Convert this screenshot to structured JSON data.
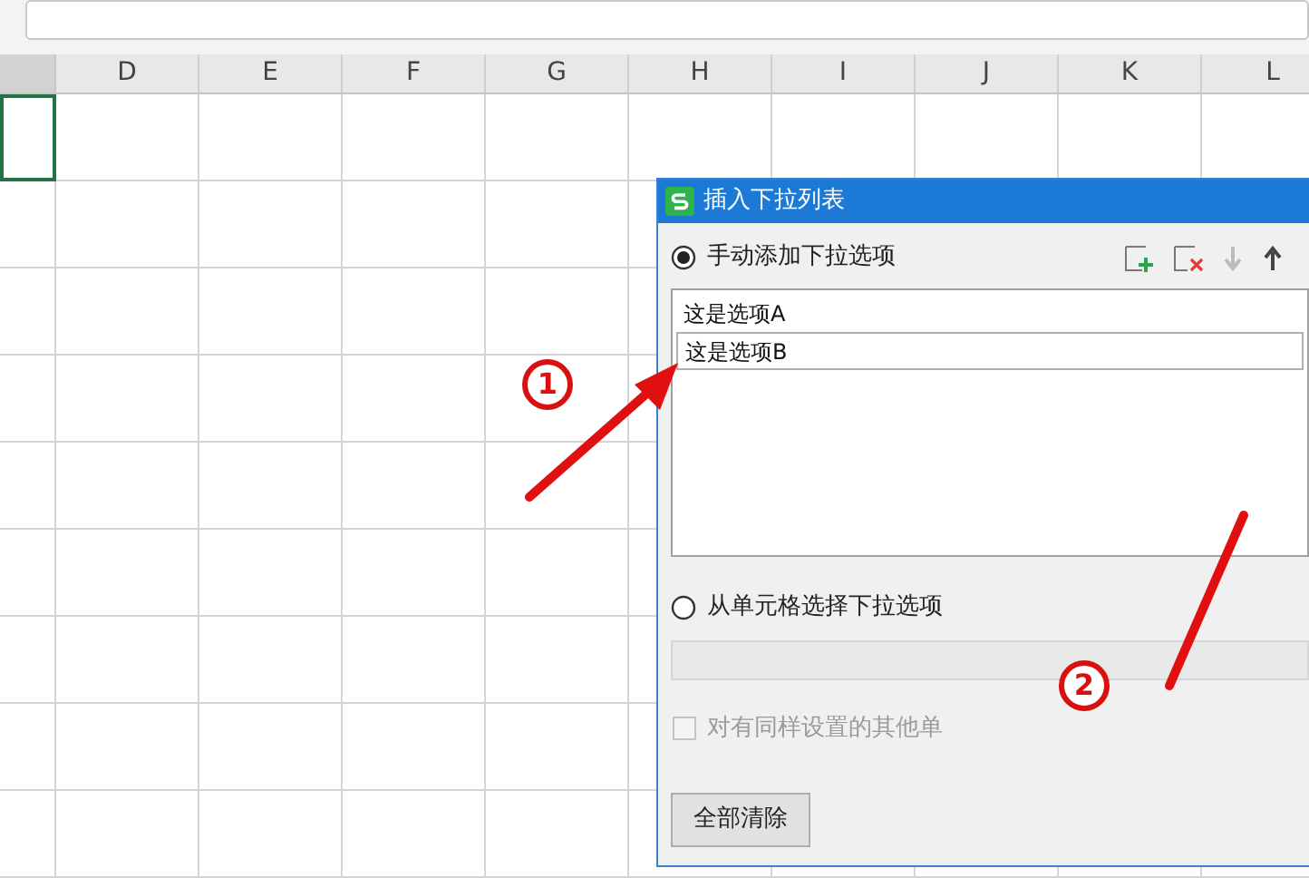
{
  "sheet": {
    "columns": [
      "D",
      "E",
      "F",
      "G",
      "H",
      "I",
      "J",
      "K",
      "L"
    ]
  },
  "dialog": {
    "title": "插入下拉列表",
    "manual_option": {
      "label": "手动添加下拉选项",
      "selected": true
    },
    "items": [
      {
        "text": "这是选项A",
        "selected": false
      },
      {
        "text": "这是选项B",
        "selected": true
      }
    ],
    "cell_option": {
      "label": "从单元格选择下拉选项",
      "selected": false
    },
    "apply_checkbox": {
      "label": "对有同样设置的其他单",
      "checked": false,
      "disabled": true
    },
    "clear_button": "全部清除"
  },
  "annotations": [
    {
      "label": "1"
    },
    {
      "label": "2"
    }
  ]
}
